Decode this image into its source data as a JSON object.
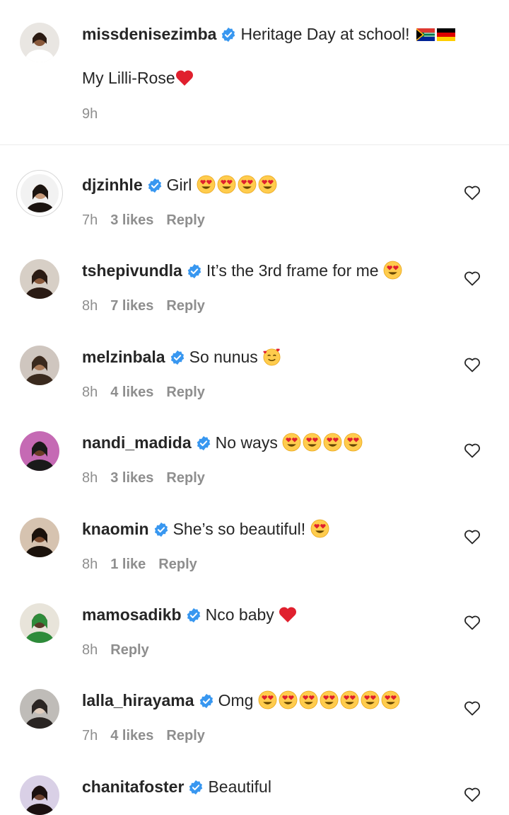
{
  "caption": {
    "username": "missdenisezimba",
    "text": "Heritage Day at school!",
    "flags": [
      "south-africa-flag-icon",
      "germany-flag-icon"
    ],
    "line2": "My Lilli-Rose",
    "line2_emoji": "red-heart-icon",
    "time": "9h"
  },
  "comments": [
    {
      "username": "djzinhle",
      "text": "Girl",
      "emoji": [
        "heart-eyes-icon",
        "heart-eyes-icon",
        "heart-eyes-icon",
        "heart-eyes-icon"
      ],
      "time": "7h",
      "likes": "3 likes",
      "reply": "Reply"
    },
    {
      "username": "tshepivundla",
      "text": "It’s the 3rd frame for me",
      "emoji": [
        "heart-eyes-icon"
      ],
      "time": "8h",
      "likes": "7 likes",
      "reply": "Reply"
    },
    {
      "username": "melzinbala",
      "text": "So nunus",
      "emoji": [
        "smiling-face-with-hearts-icon"
      ],
      "time": "8h",
      "likes": "4 likes",
      "reply": "Reply"
    },
    {
      "username": "nandi_madida",
      "text": "No ways",
      "emoji": [
        "heart-eyes-icon",
        "heart-eyes-icon",
        "heart-eyes-icon",
        "heart-eyes-icon"
      ],
      "time": "8h",
      "likes": "3 likes",
      "reply": "Reply"
    },
    {
      "username": "knaomin",
      "text": "She’s so beautiful!",
      "emoji": [
        "heart-eyes-icon"
      ],
      "time": "8h",
      "likes": "1 like",
      "reply": "Reply"
    },
    {
      "username": "mamosadikb",
      "text": "Nco baby",
      "emoji": [
        "red-heart-icon"
      ],
      "time": "8h",
      "likes": "",
      "reply": "Reply"
    },
    {
      "username": "lalla_hirayama",
      "text": "Omg",
      "emoji": [
        "heart-eyes-icon",
        "heart-eyes-icon",
        "heart-eyes-icon",
        "heart-eyes-icon",
        "heart-eyes-icon",
        "heart-eyes-icon",
        "heart-eyes-icon"
      ],
      "time": "7h",
      "likes": "4 likes",
      "reply": "Reply"
    },
    {
      "username": "chanitafoster",
      "text": "Beautiful",
      "emoji": [],
      "time": "",
      "likes": "",
      "reply": ""
    }
  ],
  "colors": {
    "verified": "#3897f0",
    "meta": "#8e8e8e",
    "text": "#262626"
  }
}
